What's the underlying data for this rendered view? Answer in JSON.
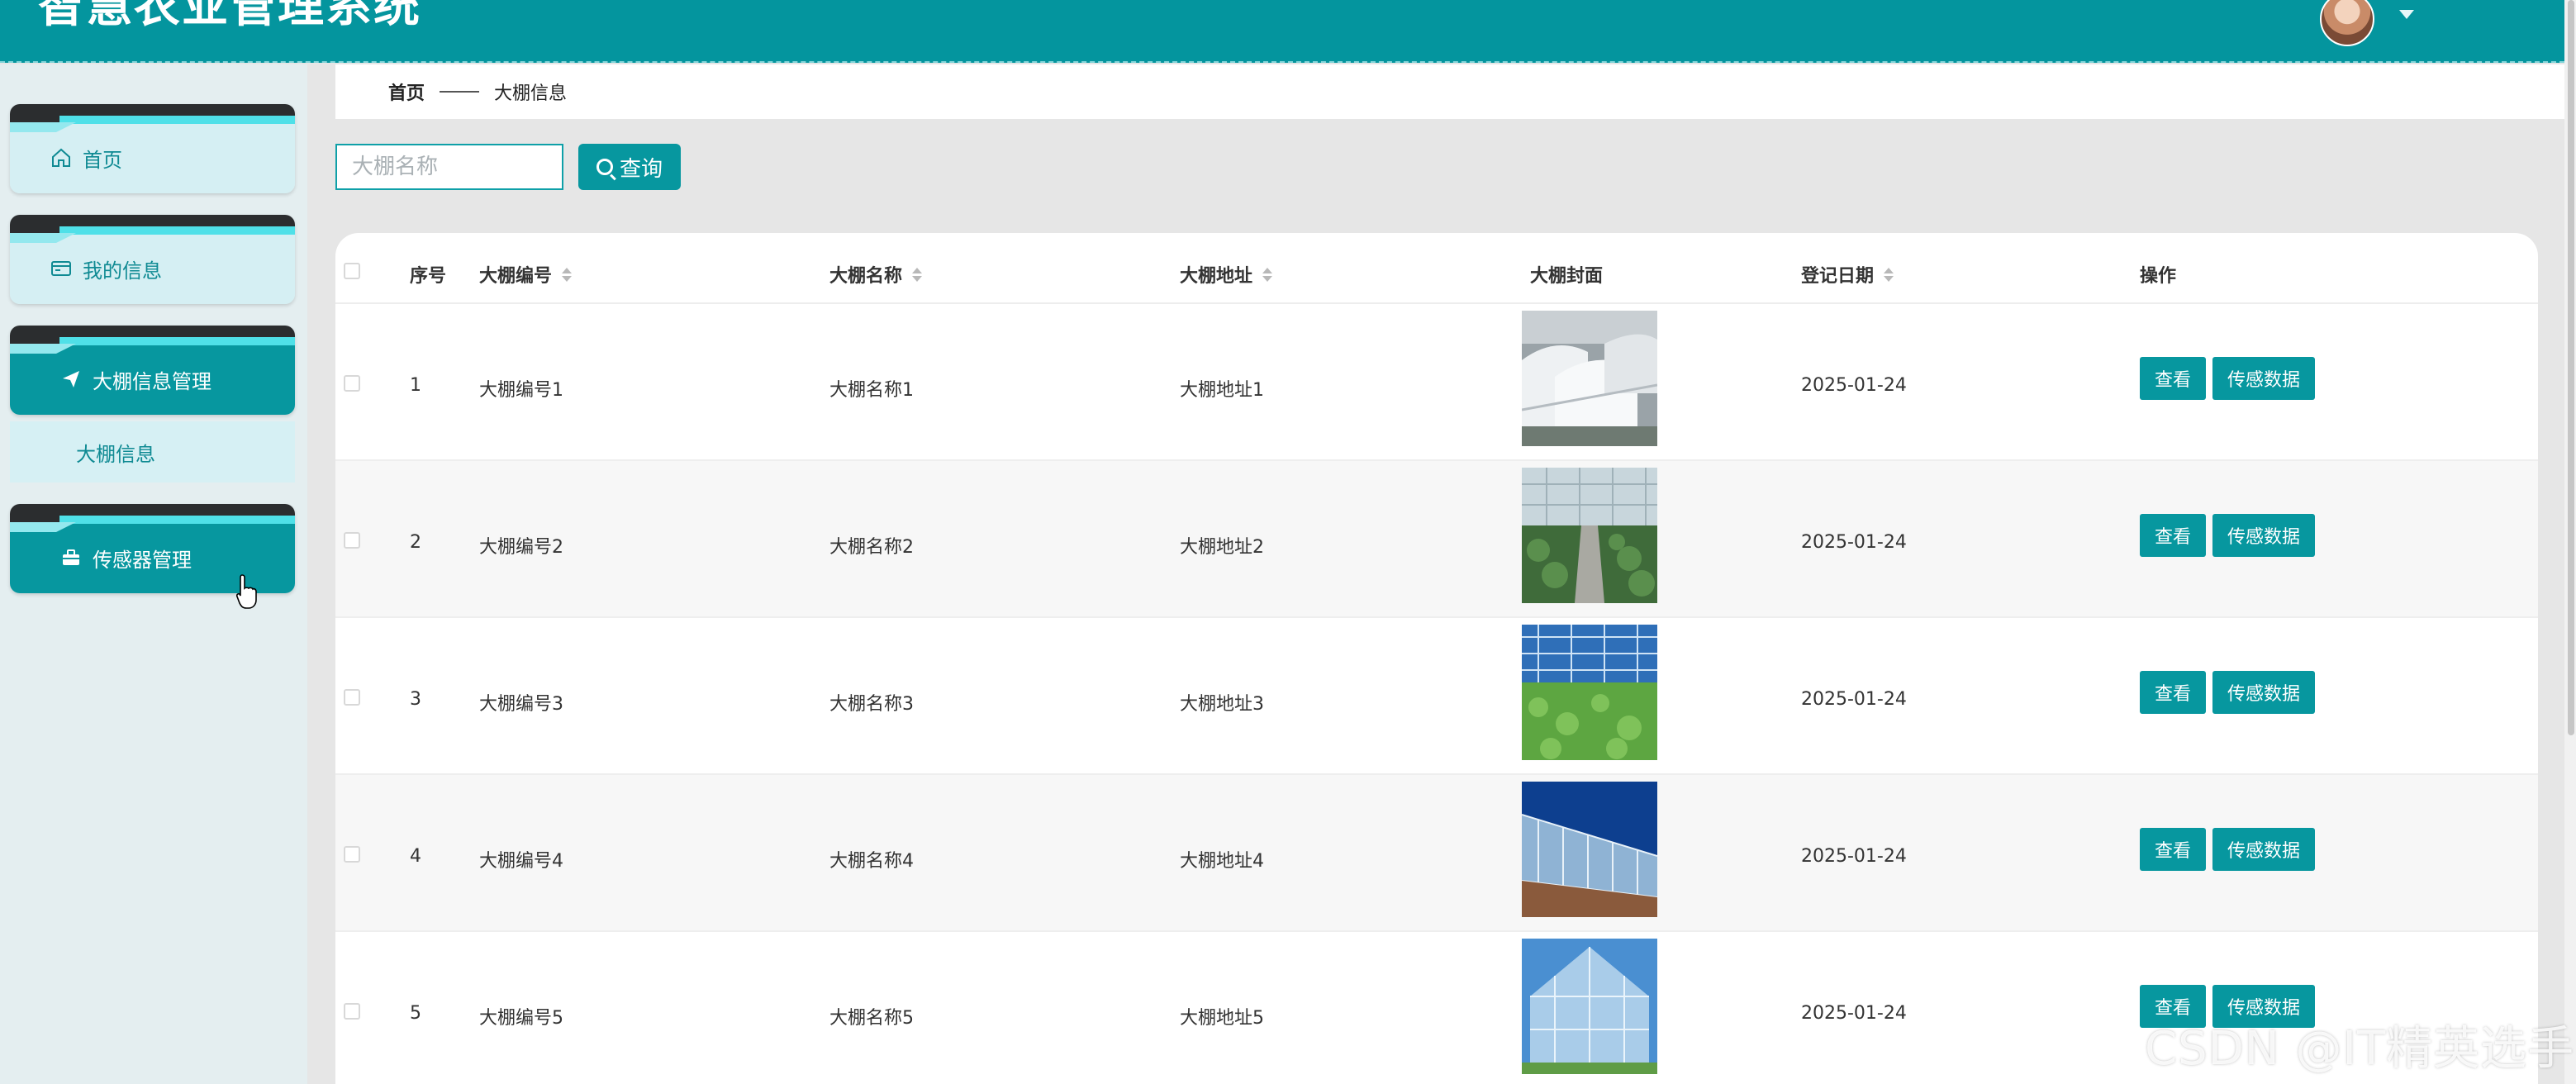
{
  "header": {
    "title": "智慧农业管理系统"
  },
  "sidebar": {
    "items": [
      {
        "label": "首页",
        "icon": "home-icon"
      },
      {
        "label": "我的信息",
        "icon": "card-icon"
      },
      {
        "label": "大棚信息管理",
        "icon": "send-icon"
      },
      {
        "label": "传感器管理",
        "icon": "briefcase-icon"
      }
    ],
    "submenu": {
      "label": "大棚信息"
    }
  },
  "breadcrumb": {
    "home": "首页",
    "current": "大棚信息"
  },
  "search": {
    "placeholder": "大棚名称",
    "button": "查询"
  },
  "table": {
    "headers": {
      "index": "序号",
      "code": "大棚编号",
      "name": "大棚名称",
      "address": "大棚地址",
      "cover": "大棚封面",
      "date": "登记日期",
      "action": "操作"
    },
    "actions": {
      "view": "查看",
      "sensor": "传感数据"
    },
    "rows": [
      {
        "index": "1",
        "code": "大棚编号1",
        "name": "大棚名称1",
        "address": "大棚地址1",
        "date": "2025-01-24"
      },
      {
        "index": "2",
        "code": "大棚编号2",
        "name": "大棚名称2",
        "address": "大棚地址2",
        "date": "2025-01-24"
      },
      {
        "index": "3",
        "code": "大棚编号3",
        "name": "大棚名称3",
        "address": "大棚地址3",
        "date": "2025-01-24"
      },
      {
        "index": "4",
        "code": "大棚编号4",
        "name": "大棚名称4",
        "address": "大棚地址4",
        "date": "2025-01-24"
      },
      {
        "index": "5",
        "code": "大棚编号5",
        "name": "大棚名称5",
        "address": "大棚地址5",
        "date": "2025-01-24"
      }
    ]
  },
  "watermark": "CSDN @IT精英选手",
  "colors": {
    "primary": "#07979f",
    "header": "#04959e",
    "sidebar_bg": "#e4eef0"
  }
}
